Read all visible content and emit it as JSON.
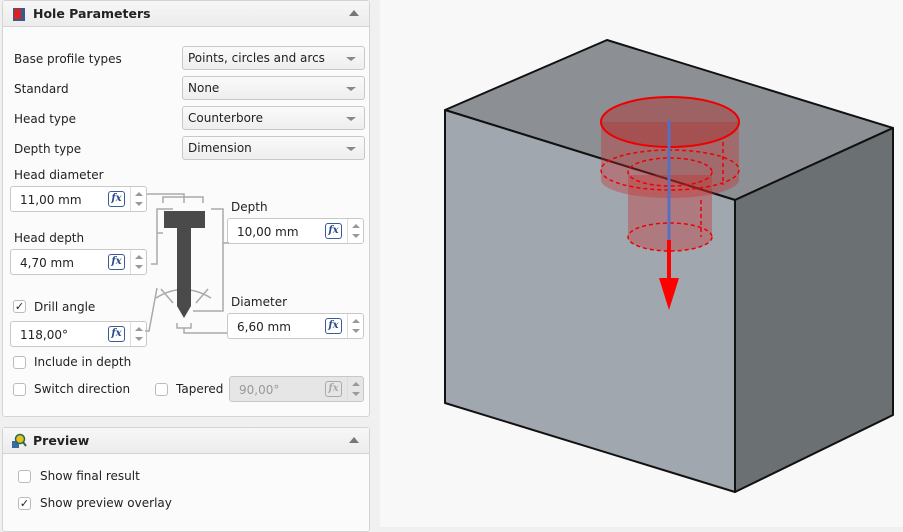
{
  "hole_parameters": {
    "title": "Hole Parameters",
    "fields": [
      {
        "label": "Base profile types",
        "value": "Points, circles and arcs"
      },
      {
        "label": "Standard",
        "value": "None"
      },
      {
        "label": "Head type",
        "value": "Counterbore"
      },
      {
        "label": "Depth type",
        "value": "Dimension"
      }
    ],
    "head_diameter": {
      "label": "Head diameter",
      "value": "11,00 mm"
    },
    "head_depth": {
      "label": "Head depth",
      "value": "4,70 mm"
    },
    "depth": {
      "label": "Depth",
      "value": "10,00 mm"
    },
    "diameter": {
      "label": "Diameter",
      "value": "6,60 mm"
    },
    "drill_angle": {
      "label": "Drill angle",
      "checked": true,
      "value": "118,00°"
    },
    "include_in_depth": {
      "label": "Include in depth",
      "checked": false
    },
    "switch_direction": {
      "label": "Switch direction",
      "checked": false
    },
    "tapered": {
      "label": "Tapered",
      "checked": false,
      "value": "90,00°"
    },
    "fx_label": "fx"
  },
  "preview": {
    "title": "Preview",
    "show_final_result": {
      "label": "Show final result",
      "checked": false
    },
    "show_preview_overlay": {
      "label": "Show preview overlay",
      "checked": true
    }
  },
  "check_mark": "✓"
}
